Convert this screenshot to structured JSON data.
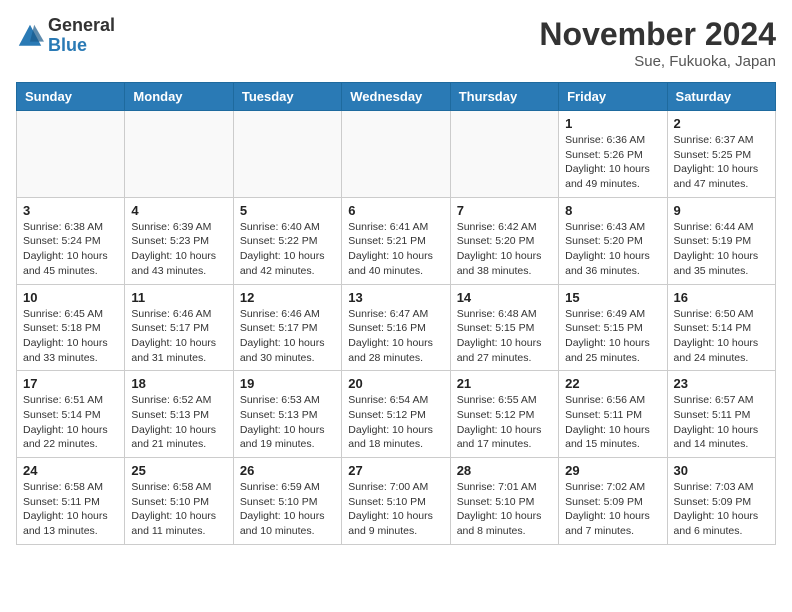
{
  "header": {
    "logo_general": "General",
    "logo_blue": "Blue",
    "month_title": "November 2024",
    "location": "Sue, Fukuoka, Japan"
  },
  "weekdays": [
    "Sunday",
    "Monday",
    "Tuesday",
    "Wednesday",
    "Thursday",
    "Friday",
    "Saturday"
  ],
  "weeks": [
    [
      {
        "day": "",
        "info": ""
      },
      {
        "day": "",
        "info": ""
      },
      {
        "day": "",
        "info": ""
      },
      {
        "day": "",
        "info": ""
      },
      {
        "day": "",
        "info": ""
      },
      {
        "day": "1",
        "info": "Sunrise: 6:36 AM\nSunset: 5:26 PM\nDaylight: 10 hours and 49 minutes."
      },
      {
        "day": "2",
        "info": "Sunrise: 6:37 AM\nSunset: 5:25 PM\nDaylight: 10 hours and 47 minutes."
      }
    ],
    [
      {
        "day": "3",
        "info": "Sunrise: 6:38 AM\nSunset: 5:24 PM\nDaylight: 10 hours and 45 minutes."
      },
      {
        "day": "4",
        "info": "Sunrise: 6:39 AM\nSunset: 5:23 PM\nDaylight: 10 hours and 43 minutes."
      },
      {
        "day": "5",
        "info": "Sunrise: 6:40 AM\nSunset: 5:22 PM\nDaylight: 10 hours and 42 minutes."
      },
      {
        "day": "6",
        "info": "Sunrise: 6:41 AM\nSunset: 5:21 PM\nDaylight: 10 hours and 40 minutes."
      },
      {
        "day": "7",
        "info": "Sunrise: 6:42 AM\nSunset: 5:20 PM\nDaylight: 10 hours and 38 minutes."
      },
      {
        "day": "8",
        "info": "Sunrise: 6:43 AM\nSunset: 5:20 PM\nDaylight: 10 hours and 36 minutes."
      },
      {
        "day": "9",
        "info": "Sunrise: 6:44 AM\nSunset: 5:19 PM\nDaylight: 10 hours and 35 minutes."
      }
    ],
    [
      {
        "day": "10",
        "info": "Sunrise: 6:45 AM\nSunset: 5:18 PM\nDaylight: 10 hours and 33 minutes."
      },
      {
        "day": "11",
        "info": "Sunrise: 6:46 AM\nSunset: 5:17 PM\nDaylight: 10 hours and 31 minutes."
      },
      {
        "day": "12",
        "info": "Sunrise: 6:46 AM\nSunset: 5:17 PM\nDaylight: 10 hours and 30 minutes."
      },
      {
        "day": "13",
        "info": "Sunrise: 6:47 AM\nSunset: 5:16 PM\nDaylight: 10 hours and 28 minutes."
      },
      {
        "day": "14",
        "info": "Sunrise: 6:48 AM\nSunset: 5:15 PM\nDaylight: 10 hours and 27 minutes."
      },
      {
        "day": "15",
        "info": "Sunrise: 6:49 AM\nSunset: 5:15 PM\nDaylight: 10 hours and 25 minutes."
      },
      {
        "day": "16",
        "info": "Sunrise: 6:50 AM\nSunset: 5:14 PM\nDaylight: 10 hours and 24 minutes."
      }
    ],
    [
      {
        "day": "17",
        "info": "Sunrise: 6:51 AM\nSunset: 5:14 PM\nDaylight: 10 hours and 22 minutes."
      },
      {
        "day": "18",
        "info": "Sunrise: 6:52 AM\nSunset: 5:13 PM\nDaylight: 10 hours and 21 minutes."
      },
      {
        "day": "19",
        "info": "Sunrise: 6:53 AM\nSunset: 5:13 PM\nDaylight: 10 hours and 19 minutes."
      },
      {
        "day": "20",
        "info": "Sunrise: 6:54 AM\nSunset: 5:12 PM\nDaylight: 10 hours and 18 minutes."
      },
      {
        "day": "21",
        "info": "Sunrise: 6:55 AM\nSunset: 5:12 PM\nDaylight: 10 hours and 17 minutes."
      },
      {
        "day": "22",
        "info": "Sunrise: 6:56 AM\nSunset: 5:11 PM\nDaylight: 10 hours and 15 minutes."
      },
      {
        "day": "23",
        "info": "Sunrise: 6:57 AM\nSunset: 5:11 PM\nDaylight: 10 hours and 14 minutes."
      }
    ],
    [
      {
        "day": "24",
        "info": "Sunrise: 6:58 AM\nSunset: 5:11 PM\nDaylight: 10 hours and 13 minutes."
      },
      {
        "day": "25",
        "info": "Sunrise: 6:58 AM\nSunset: 5:10 PM\nDaylight: 10 hours and 11 minutes."
      },
      {
        "day": "26",
        "info": "Sunrise: 6:59 AM\nSunset: 5:10 PM\nDaylight: 10 hours and 10 minutes."
      },
      {
        "day": "27",
        "info": "Sunrise: 7:00 AM\nSunset: 5:10 PM\nDaylight: 10 hours and 9 minutes."
      },
      {
        "day": "28",
        "info": "Sunrise: 7:01 AM\nSunset: 5:10 PM\nDaylight: 10 hours and 8 minutes."
      },
      {
        "day": "29",
        "info": "Sunrise: 7:02 AM\nSunset: 5:09 PM\nDaylight: 10 hours and 7 minutes."
      },
      {
        "day": "30",
        "info": "Sunrise: 7:03 AM\nSunset: 5:09 PM\nDaylight: 10 hours and 6 minutes."
      }
    ]
  ]
}
